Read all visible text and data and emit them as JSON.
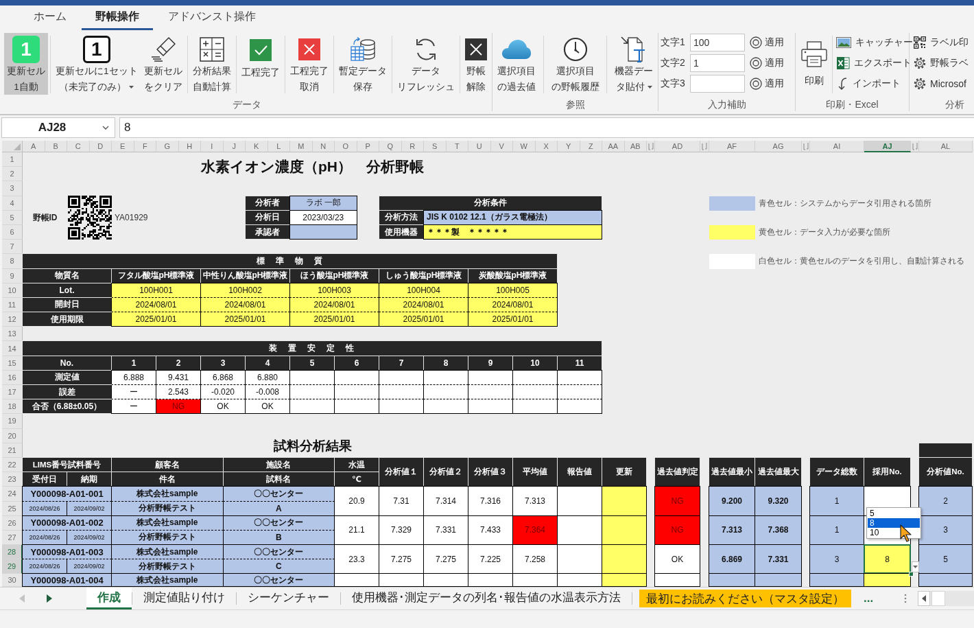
{
  "ribbon_tabs": [
    {
      "label": "ホーム",
      "selected": false
    },
    {
      "label": "野帳操作",
      "selected": true
    },
    {
      "label": "アドバンスト操作",
      "selected": false
    }
  ],
  "ribbon": [
    {
      "kind": "large",
      "label": "データ",
      "sets": [
        [
          {
            "kind": "auto",
            "badge": "1",
            "lines": [
              "更新セル",
              "1自動"
            ],
            "pressed": true,
            "dropdown": false
          }
        ],
        [
          {
            "kind": "set",
            "badge": "1",
            "lines": [
              "更新セルに1セット",
              "（未完了のみ）"
            ],
            "pressed": false,
            "dropdown": true
          },
          {
            "kind": "clear",
            "lines": [
              "更新セル",
              "をクリア"
            ],
            "pressed": false,
            "dropdown": false
          }
        ],
        [
          {
            "kind": "calc",
            "lines": [
              "分析結果",
              "自動計算"
            ],
            "pressed": false,
            "dropdown": false
          }
        ],
        [
          {
            "kind": "complete",
            "lines": [
              "工程完了"
            ],
            "pressed": false,
            "dropdown": false
          }
        ],
        [
          {
            "kind": "cancel",
            "lines": [
              "工程完了",
              "取消"
            ],
            "pressed": false,
            "dropdown": false
          }
        ],
        [
          {
            "kind": "save",
            "lines": [
              "暫定データ",
              "保存"
            ],
            "pressed": false,
            "dropdown": false
          }
        ],
        [
          {
            "kind": "refresh",
            "lines": [
              "データ",
              "リフレッシュ"
            ],
            "pressed": false,
            "dropdown": false
          }
        ],
        [
          {
            "kind": "release",
            "lines": [
              "野帳",
              "解除"
            ],
            "pressed": false,
            "dropdown": false
          }
        ]
      ]
    },
    {
      "kind": "large",
      "label": "参照",
      "sets": [
        [
          {
            "kind": "past",
            "lines": [
              "選択項目",
              "の過去値"
            ],
            "pressed": false,
            "dropdown": false
          }
        ],
        [
          {
            "kind": "history",
            "lines": [
              "選択項目",
              "の野帳履歴"
            ],
            "pressed": false,
            "dropdown": false
          }
        ],
        [
          {
            "kind": "paste",
            "lines": [
              "機器デー",
              "タ貼付"
            ],
            "pressed": false,
            "dropdown": true
          }
        ]
      ]
    },
    {
      "kind": "inputs",
      "label": "入力補助",
      "fields": [
        {
          "label": "文字1",
          "value": "100",
          "button": "適用"
        },
        {
          "label": "文字2",
          "value": "1",
          "button": "適用"
        },
        {
          "label": "文字3",
          "button": "適用"
        }
      ]
    },
    {
      "kind": "print",
      "label": "印刷・Excel",
      "main": {
        "kind": "print",
        "label": "印刷"
      },
      "items": [
        {
          "kind": "capture",
          "label": "キャッチャー"
        },
        {
          "kind": "export",
          "label": "エクスポート"
        },
        {
          "kind": "import",
          "label": "インポート"
        }
      ]
    },
    {
      "kind": "list",
      "label": "分析",
      "items": [
        {
          "kind": "label",
          "label": "ラベル印"
        },
        {
          "kind": "settings",
          "label": "野帳ラベ"
        },
        {
          "kind": "settings",
          "label": "Microsof"
        }
      ]
    }
  ],
  "formula_bar": {
    "name_box": "AJ28",
    "formula": "8"
  },
  "sheet": {
    "columns": [
      {
        "kind": "column",
        "label": "A",
        "selected": false
      },
      {
        "kind": "column",
        "label": "B",
        "selected": false
      },
      {
        "kind": "column",
        "label": "C",
        "selected": false
      },
      {
        "kind": "column",
        "label": "D",
        "selected": false
      },
      {
        "kind": "column",
        "label": "E",
        "selected": false
      },
      {
        "kind": "column",
        "label": "F",
        "selected": false
      },
      {
        "kind": "column",
        "label": "G",
        "selected": false
      },
      {
        "kind": "column",
        "label": "H",
        "selected": false
      },
      {
        "kind": "column",
        "label": "I",
        "selected": false
      },
      {
        "kind": "column",
        "label": "J",
        "selected": false
      },
      {
        "kind": "column",
        "label": "K",
        "selected": false
      },
      {
        "kind": "column",
        "label": "L",
        "selected": false
      },
      {
        "kind": "column",
        "label": "M",
        "selected": false
      },
      {
        "kind": "column",
        "label": "N",
        "selected": false
      },
      {
        "kind": "column",
        "label": "O",
        "selected": false
      },
      {
        "kind": "column",
        "label": "P",
        "selected": false
      },
      {
        "kind": "column",
        "label": "Q",
        "selected": false
      },
      {
        "kind": "column",
        "label": "R",
        "selected": false
      },
      {
        "kind": "column",
        "label": "S",
        "selected": false
      },
      {
        "kind": "column",
        "label": "T",
        "selected": false
      },
      {
        "kind": "column",
        "label": "U",
        "selected": false
      },
      {
        "kind": "column",
        "label": "V",
        "selected": false
      },
      {
        "kind": "column",
        "label": "W",
        "selected": false
      },
      {
        "kind": "column",
        "label": "X",
        "selected": false
      },
      {
        "kind": "column",
        "label": "Y",
        "selected": false
      },
      {
        "kind": "column",
        "label": "Z",
        "selected": false
      },
      {
        "kind": "column",
        "label": "AA",
        "selected": false
      },
      {
        "kind": "column",
        "label": "AB",
        "selected": false
      },
      {
        "kind": "hidden"
      },
      {
        "kind": "column",
        "label": "AD",
        "selected": false
      },
      {
        "kind": "hidden"
      },
      {
        "kind": "column",
        "label": "AF",
        "selected": false
      },
      {
        "kind": "column",
        "label": "AG",
        "selected": false
      },
      {
        "kind": "hidden"
      },
      {
        "kind": "column",
        "label": "AI",
        "selected": false
      },
      {
        "kind": "column",
        "label": "AJ",
        "selected": true
      },
      {
        "kind": "hidden"
      },
      {
        "kind": "column",
        "label": "AL",
        "selected": false
      }
    ],
    "rows": [
      {
        "label": "1",
        "selected": false
      },
      {
        "label": "2",
        "selected": false
      },
      {
        "label": "3",
        "selected": false
      },
      {
        "label": "4",
        "selected": false
      },
      {
        "label": "5",
        "selected": false
      },
      {
        "label": "6",
        "selected": false
      },
      {
        "label": "7",
        "selected": false
      },
      {
        "label": "8",
        "selected": false
      },
      {
        "label": "9",
        "selected": false
      },
      {
        "label": "10",
        "selected": false
      },
      {
        "label": "11",
        "selected": false
      },
      {
        "label": "12",
        "selected": false
      },
      {
        "label": "13",
        "selected": false
      },
      {
        "label": "14",
        "selected": false
      },
      {
        "label": "15",
        "selected": false
      },
      {
        "label": "16",
        "selected": false
      },
      {
        "label": "17",
        "selected": false
      },
      {
        "label": "18",
        "selected": false
      },
      {
        "label": "19",
        "selected": false
      },
      {
        "label": "20",
        "selected": false
      },
      {
        "label": "21",
        "selected": false
      },
      {
        "label": "22",
        "selected": false
      },
      {
        "label": "23",
        "selected": false
      },
      {
        "label": "24",
        "selected": false
      },
      {
        "label": "25",
        "selected": false
      },
      {
        "label": "26",
        "selected": false
      },
      {
        "label": "27",
        "selected": false
      },
      {
        "label": "28",
        "selected": true
      },
      {
        "label": "29",
        "selected": true
      },
      {
        "label": "30",
        "selected": false
      }
    ]
  },
  "title": "水素イオン濃度（pH）　分析野帳",
  "notebook_id": {
    "label": "野帳ID",
    "value": "YA01929"
  },
  "staff": [
    {
      "label": "分析者",
      "value": "ラボ 一郎",
      "kind": "system"
    },
    {
      "label": "分析日",
      "value": "2023/03/23",
      "kind": "calc"
    },
    {
      "label": "承認者",
      "kind": "system"
    }
  ],
  "conditions": {
    "title": "分析条件",
    "rows": [
      {
        "label": "分析方法",
        "value": "JIS K 0102 12.1（ガラス電極法）",
        "kind": "system"
      },
      {
        "label": "使用機器",
        "value": "＊＊＊製　＊＊＊＊＊",
        "kind": "input"
      }
    ]
  },
  "legend": [
    {
      "kind": "system",
      "text": "青色セル：システムからデータ引用される箇所"
    },
    {
      "kind": "input",
      "text": "黄色セル：データ入力が必要な箇所"
    },
    {
      "kind": "calc",
      "text": "白色セル：黄色セルのデータを引用し、自動計算される"
    }
  ],
  "standards": {
    "title": "標　準　物　質",
    "header": "物質名",
    "columns": [
      "フタル酸塩pH標準液",
      "中性りん酸塩pH標準液",
      "ほう酸塩pH標準液",
      "しゅう酸塩pH標準液",
      "炭酸酸塩pH標準液"
    ],
    "rows": [
      {
        "label": "Lot.",
        "kind": "input",
        "values": [
          "100H001",
          "100H002",
          "100H003",
          "100H004",
          "100H005"
        ]
      },
      {
        "label": "開封日",
        "kind": "input",
        "values": [
          "2024/08/01",
          "2024/08/01",
          "2024/08/01",
          "2024/08/01",
          "2024/08/01"
        ]
      },
      {
        "label": "使用期限",
        "kind": "input",
        "values": [
          "2025/01/01",
          "2025/01/01",
          "2025/01/01",
          "2025/01/01",
          "2025/01/01"
        ]
      }
    ]
  },
  "stability": {
    "title": "装　置　安　定　性",
    "header": "No.",
    "numbers": [
      "1",
      "2",
      "3",
      "4",
      "5",
      "6",
      "7",
      "8",
      "9",
      "10",
      "11"
    ],
    "rows": [
      {
        "label": "測定値",
        "kind": "calc",
        "values": [
          "6.888",
          "9.431",
          "6.868",
          "6.880"
        ]
      },
      {
        "label": "誤差",
        "kind": "calc",
        "values": [
          "ー",
          "2.543",
          "-0.020",
          "-0.008"
        ]
      },
      {
        "label": "合否（6.88±0.05）",
        "kind": "calc",
        "values": [
          {
            "text": "ー",
            "alert": false
          },
          {
            "text": "NG",
            "alert": true
          },
          {
            "text": "OK",
            "alert": false
          },
          {
            "text": "OK",
            "alert": false
          }
        ]
      }
    ]
  },
  "results": {
    "title": "試料分析結果",
    "header": {
      "sample_no": "LIMS番号試料番号",
      "received": "受付日",
      "due": "納期",
      "customer": "顧客名",
      "subject": "件名",
      "facility": "施設名",
      "sample": "試料名",
      "temp": "水温",
      "temp_unit": "℃",
      "value_1": "分析値１",
      "value_2": "分析値２",
      "value_3": "分析値３",
      "average": "平均値",
      "report": "報告値",
      "update": "更新",
      "past_judgement": "過去値判定",
      "past_min": "過去値最小",
      "past_max": "過去値最大",
      "count": "データ総数",
      "adopted": "採用No.",
      "value_no": "分析値No."
    },
    "rows": [
      {
        "sample_no": "Y000098-A01-001",
        "received": "2024/08/26",
        "due": "2024/09/02",
        "customer": "株式会社sample",
        "subject": "分析野帳テスト",
        "facility": "〇〇センター",
        "sample": "A",
        "temp": "20.9",
        "value_1": "7.31",
        "value_2": "7.314",
        "value_3": "7.316",
        "average": {
          "text": "7.313",
          "alert": false
        },
        "past_judgement": {
          "text": "NG",
          "alert": true
        },
        "past_min": "9.200",
        "past_max": "9.320",
        "count": "1",
        "adopted": {
          "input": false,
          "selected": false
        },
        "value_no": "2"
      },
      {
        "sample_no": "Y000098-A01-002",
        "received": "2024/08/26",
        "due": "2024/09/02",
        "customer": "株式会社sample",
        "subject": "分析野帳テスト",
        "facility": "〇〇センター",
        "sample": "B",
        "temp": "21.1",
        "value_1": "7.329",
        "value_2": "7.331",
        "value_3": "7.433",
        "average": {
          "text": "7.364",
          "alert": true
        },
        "past_judgement": {
          "text": "NG",
          "alert": true
        },
        "past_min": "7.313",
        "past_max": "7.368",
        "count": "1",
        "adopted": {
          "input": false,
          "selected": false
        },
        "value_no": "3"
      },
      {
        "sample_no": "Y000098-A01-003",
        "received": "2024/08/26",
        "due": "2024/09/02",
        "customer": "株式会社sample",
        "subject": "分析野帳テスト",
        "facility": "〇〇センター",
        "sample": "C",
        "temp": "23.3",
        "value_1": "7.275",
        "value_2": "7.275",
        "value_3": "7.225",
        "average": {
          "text": "7.258",
          "alert": false
        },
        "past_judgement": {
          "text": "OK",
          "alert": false
        },
        "past_min": "6.869",
        "past_max": "7.331",
        "count": "3",
        "adopted": {
          "text": "8",
          "input": true,
          "selected": true,
          "options": [
            {
              "label": "5",
              "selected": false
            },
            {
              "label": "8",
              "selected": true
            },
            {
              "label": "10",
              "selected": false
            }
          ]
        },
        "value_no": "5"
      },
      {
        "sample_no": "Y000098-A01-004",
        "customer": "株式会社sample",
        "facility": "〇〇センター",
        "average": {
          "alert": false
        },
        "past_judgement": {
          "alert": false
        },
        "adopted": {
          "input": true,
          "selected": false
        }
      }
    ]
  },
  "sheet_nav": [
    {
      "kind": "prev",
      "disabled": true
    },
    {
      "kind": "next",
      "disabled": false
    }
  ],
  "sheet_tabs": [
    {
      "label": "作成",
      "selected": true
    },
    {
      "label": "測定値貼り付け",
      "selected": false
    },
    {
      "label": "シーケンチャー",
      "selected": false
    },
    {
      "label": "使用機器･測定データの列名･報告値の水温表示方法",
      "selected": false
    },
    {
      "label": "最初にお読みください（マスタ設定）",
      "selected": false,
      "color": "#ffc000"
    }
  ],
  "sheet_tabs_more": "..."
}
